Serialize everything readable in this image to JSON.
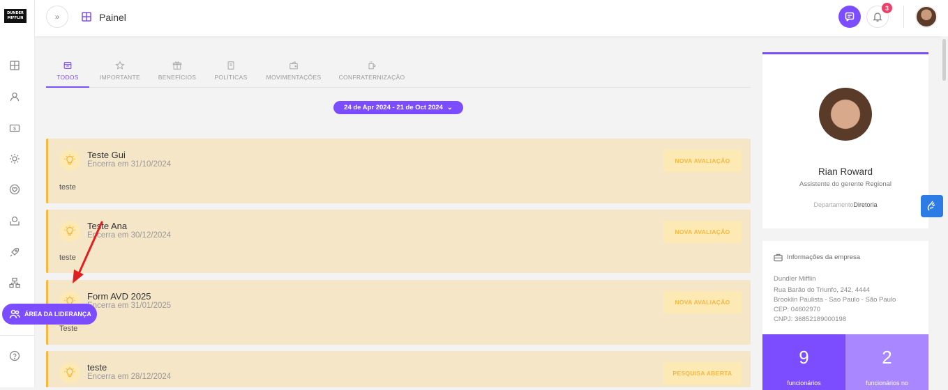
{
  "app": {
    "logo_text": "DUNDER MIFFLIN",
    "page_title": "Painel",
    "notification_count": "3"
  },
  "tabs": [
    {
      "label": "TODOS",
      "icon": "inbox-icon",
      "active": true
    },
    {
      "label": "IMPORTANTE",
      "icon": "star-icon",
      "active": false
    },
    {
      "label": "BENEFÍCIOS",
      "icon": "gift-icon",
      "active": false
    },
    {
      "label": "POLÍTICAS",
      "icon": "document-icon",
      "active": false
    },
    {
      "label": "MOVIMENTAÇÕES",
      "icon": "wallet-icon",
      "active": false
    },
    {
      "label": "CONFRATERNIZAÇÃO",
      "icon": "mug-icon",
      "active": false
    }
  ],
  "date_range": "24 de Apr 2024 - 21 de Oct 2024",
  "cards": [
    {
      "title": "Teste Gui",
      "subtitle": "Encerra em 31/10/2024",
      "body": "teste",
      "action": "NOVA AVALIAÇÃO"
    },
    {
      "title": "Teste Ana",
      "subtitle": "Encerra em 30/12/2024",
      "body": "teste",
      "action": "NOVA AVALIAÇÃO"
    },
    {
      "title": "Form AVD 2025",
      "subtitle": "Encerra em 31/01/2025",
      "body": "Teste",
      "action": "NOVA AVALIAÇÃO"
    },
    {
      "title": "teste",
      "subtitle": "Encerra em 28/12/2024",
      "body": "",
      "action": "PESQUISA ABERTA"
    }
  ],
  "leadership_button": "ÁREA DA LIDERANÇA",
  "profile": {
    "name": "Rian Roward",
    "role": "Assistente do gerente Regional",
    "dept_label": "Departamento",
    "dept_value": "Diretoria"
  },
  "company": {
    "heading": "Informações da empresa",
    "lines": [
      "Dundler Mifflin",
      "Rua Barão do Triunfo, 242, 4444",
      "Brooklin Paulista - Sao Paulo - São Paulo",
      "CEP: 04602970",
      "CNPJ: 36852189000198"
    ],
    "stats": [
      {
        "number": "9",
        "label": "funcionários",
        "color": "#7c4dff"
      },
      {
        "number": "2",
        "label": "funcionários no",
        "color": "#a987ff"
      }
    ]
  },
  "colors": {
    "accent": "#7c4dff",
    "card_bg": "#f5e6c8",
    "card_border": "#f5b942",
    "badge": "#f03e6b",
    "arrow": "#e02020"
  }
}
